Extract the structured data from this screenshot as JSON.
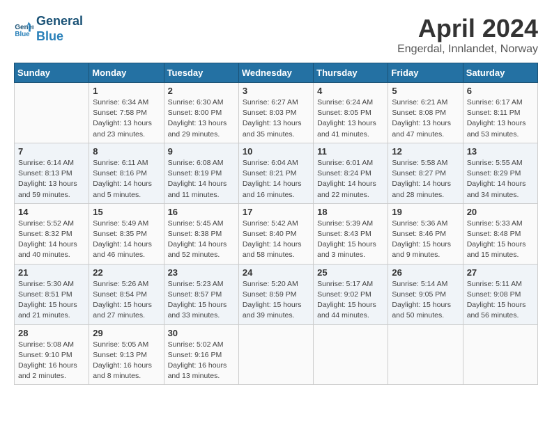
{
  "header": {
    "logo_line1": "General",
    "logo_line2": "Blue",
    "month": "April 2024",
    "location": "Engerdal, Innlandet, Norway"
  },
  "weekdays": [
    "Sunday",
    "Monday",
    "Tuesday",
    "Wednesday",
    "Thursday",
    "Friday",
    "Saturday"
  ],
  "weeks": [
    [
      {
        "day": "",
        "info": ""
      },
      {
        "day": "1",
        "info": "Sunrise: 6:34 AM\nSunset: 7:58 PM\nDaylight: 13 hours\nand 23 minutes."
      },
      {
        "day": "2",
        "info": "Sunrise: 6:30 AM\nSunset: 8:00 PM\nDaylight: 13 hours\nand 29 minutes."
      },
      {
        "day": "3",
        "info": "Sunrise: 6:27 AM\nSunset: 8:03 PM\nDaylight: 13 hours\nand 35 minutes."
      },
      {
        "day": "4",
        "info": "Sunrise: 6:24 AM\nSunset: 8:05 PM\nDaylight: 13 hours\nand 41 minutes."
      },
      {
        "day": "5",
        "info": "Sunrise: 6:21 AM\nSunset: 8:08 PM\nDaylight: 13 hours\nand 47 minutes."
      },
      {
        "day": "6",
        "info": "Sunrise: 6:17 AM\nSunset: 8:11 PM\nDaylight: 13 hours\nand 53 minutes."
      }
    ],
    [
      {
        "day": "7",
        "info": "Sunrise: 6:14 AM\nSunset: 8:13 PM\nDaylight: 13 hours\nand 59 minutes."
      },
      {
        "day": "8",
        "info": "Sunrise: 6:11 AM\nSunset: 8:16 PM\nDaylight: 14 hours\nand 5 minutes."
      },
      {
        "day": "9",
        "info": "Sunrise: 6:08 AM\nSunset: 8:19 PM\nDaylight: 14 hours\nand 11 minutes."
      },
      {
        "day": "10",
        "info": "Sunrise: 6:04 AM\nSunset: 8:21 PM\nDaylight: 14 hours\nand 16 minutes."
      },
      {
        "day": "11",
        "info": "Sunrise: 6:01 AM\nSunset: 8:24 PM\nDaylight: 14 hours\nand 22 minutes."
      },
      {
        "day": "12",
        "info": "Sunrise: 5:58 AM\nSunset: 8:27 PM\nDaylight: 14 hours\nand 28 minutes."
      },
      {
        "day": "13",
        "info": "Sunrise: 5:55 AM\nSunset: 8:29 PM\nDaylight: 14 hours\nand 34 minutes."
      }
    ],
    [
      {
        "day": "14",
        "info": "Sunrise: 5:52 AM\nSunset: 8:32 PM\nDaylight: 14 hours\nand 40 minutes."
      },
      {
        "day": "15",
        "info": "Sunrise: 5:49 AM\nSunset: 8:35 PM\nDaylight: 14 hours\nand 46 minutes."
      },
      {
        "day": "16",
        "info": "Sunrise: 5:45 AM\nSunset: 8:38 PM\nDaylight: 14 hours\nand 52 minutes."
      },
      {
        "day": "17",
        "info": "Sunrise: 5:42 AM\nSunset: 8:40 PM\nDaylight: 14 hours\nand 58 minutes."
      },
      {
        "day": "18",
        "info": "Sunrise: 5:39 AM\nSunset: 8:43 PM\nDaylight: 15 hours\nand 3 minutes."
      },
      {
        "day": "19",
        "info": "Sunrise: 5:36 AM\nSunset: 8:46 PM\nDaylight: 15 hours\nand 9 minutes."
      },
      {
        "day": "20",
        "info": "Sunrise: 5:33 AM\nSunset: 8:48 PM\nDaylight: 15 hours\nand 15 minutes."
      }
    ],
    [
      {
        "day": "21",
        "info": "Sunrise: 5:30 AM\nSunset: 8:51 PM\nDaylight: 15 hours\nand 21 minutes."
      },
      {
        "day": "22",
        "info": "Sunrise: 5:26 AM\nSunset: 8:54 PM\nDaylight: 15 hours\nand 27 minutes."
      },
      {
        "day": "23",
        "info": "Sunrise: 5:23 AM\nSunset: 8:57 PM\nDaylight: 15 hours\nand 33 minutes."
      },
      {
        "day": "24",
        "info": "Sunrise: 5:20 AM\nSunset: 8:59 PM\nDaylight: 15 hours\nand 39 minutes."
      },
      {
        "day": "25",
        "info": "Sunrise: 5:17 AM\nSunset: 9:02 PM\nDaylight: 15 hours\nand 44 minutes."
      },
      {
        "day": "26",
        "info": "Sunrise: 5:14 AM\nSunset: 9:05 PM\nDaylight: 15 hours\nand 50 minutes."
      },
      {
        "day": "27",
        "info": "Sunrise: 5:11 AM\nSunset: 9:08 PM\nDaylight: 15 hours\nand 56 minutes."
      }
    ],
    [
      {
        "day": "28",
        "info": "Sunrise: 5:08 AM\nSunset: 9:10 PM\nDaylight: 16 hours\nand 2 minutes."
      },
      {
        "day": "29",
        "info": "Sunrise: 5:05 AM\nSunset: 9:13 PM\nDaylight: 16 hours\nand 8 minutes."
      },
      {
        "day": "30",
        "info": "Sunrise: 5:02 AM\nSunset: 9:16 PM\nDaylight: 16 hours\nand 13 minutes."
      },
      {
        "day": "",
        "info": ""
      },
      {
        "day": "",
        "info": ""
      },
      {
        "day": "",
        "info": ""
      },
      {
        "day": "",
        "info": ""
      }
    ]
  ]
}
